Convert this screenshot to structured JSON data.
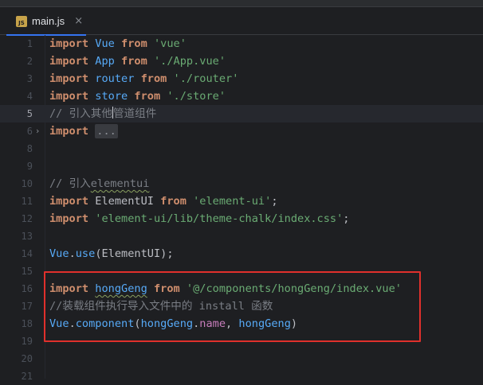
{
  "tab": {
    "icon": "javascript-file-icon",
    "icon_text": "JS",
    "label": "main.js",
    "close": "×"
  },
  "lines": [
    {
      "n": "1",
      "tokens": [
        {
          "t": "import",
          "c": "kw"
        },
        {
          "t": " "
        },
        {
          "t": "Vue",
          "c": "fn"
        },
        {
          "t": " "
        },
        {
          "t": "from",
          "c": "kw"
        },
        {
          "t": " "
        },
        {
          "t": "'vue'",
          "c": "str"
        }
      ]
    },
    {
      "n": "2",
      "tokens": [
        {
          "t": "import",
          "c": "kw"
        },
        {
          "t": " "
        },
        {
          "t": "App",
          "c": "fn"
        },
        {
          "t": " "
        },
        {
          "t": "from",
          "c": "kw"
        },
        {
          "t": " "
        },
        {
          "t": "'./App.vue'",
          "c": "str"
        }
      ]
    },
    {
      "n": "3",
      "tokens": [
        {
          "t": "import",
          "c": "kw"
        },
        {
          "t": " "
        },
        {
          "t": "router",
          "c": "fn"
        },
        {
          "t": " "
        },
        {
          "t": "from",
          "c": "kw"
        },
        {
          "t": " "
        },
        {
          "t": "'./router'",
          "c": "str"
        }
      ]
    },
    {
      "n": "4",
      "tokens": [
        {
          "t": "import",
          "c": "kw"
        },
        {
          "t": " "
        },
        {
          "t": "store",
          "c": "fn"
        },
        {
          "t": " "
        },
        {
          "t": "from",
          "c": "kw"
        },
        {
          "t": " "
        },
        {
          "t": "'./store'",
          "c": "str"
        }
      ]
    },
    {
      "n": "5",
      "current": true,
      "tokens": [
        {
          "t": "// ",
          "c": "cm"
        },
        {
          "t": "引入其他",
          "c": "cm cjk"
        },
        {
          "t": "",
          "c": "caret"
        },
        {
          "t": "管道组件",
          "c": "cm cjk"
        }
      ]
    },
    {
      "n": "6",
      "fold": "›",
      "tokens": [
        {
          "t": "import",
          "c": "kw"
        },
        {
          "t": " "
        },
        {
          "t": "...",
          "c": "folded"
        }
      ]
    },
    {
      "n": "8",
      "tokens": []
    },
    {
      "n": "9",
      "tokens": []
    },
    {
      "n": "10",
      "tokens": [
        {
          "t": "// ",
          "c": "cm"
        },
        {
          "t": "引入",
          "c": "cm cjk"
        },
        {
          "t": "elementui",
          "c": "cm typo"
        }
      ]
    },
    {
      "n": "11",
      "tokens": [
        {
          "t": "import",
          "c": "kw"
        },
        {
          "t": " "
        },
        {
          "t": "ElementUI",
          "c": "id"
        },
        {
          "t": " "
        },
        {
          "t": "from",
          "c": "kw"
        },
        {
          "t": " "
        },
        {
          "t": "'element-ui'",
          "c": "str"
        },
        {
          "t": ";"
        }
      ]
    },
    {
      "n": "12",
      "tokens": [
        {
          "t": "import",
          "c": "kw"
        },
        {
          "t": " "
        },
        {
          "t": "'element-ui/lib/theme-chalk/index.css'",
          "c": "str"
        },
        {
          "t": ";"
        }
      ]
    },
    {
      "n": "13",
      "tokens": []
    },
    {
      "n": "14",
      "tokens": [
        {
          "t": "Vue",
          "c": "fn"
        },
        {
          "t": "."
        },
        {
          "t": "use",
          "c": "fn"
        },
        {
          "t": "(ElementUI);"
        }
      ]
    },
    {
      "n": "15",
      "tokens": []
    },
    {
      "n": "16",
      "tokens": [
        {
          "t": "import",
          "c": "kw"
        },
        {
          "t": " "
        },
        {
          "t": "hongGeng",
          "c": "fn typo"
        },
        {
          "t": " "
        },
        {
          "t": "from",
          "c": "kw"
        },
        {
          "t": " "
        },
        {
          "t": "'@/components/hongGeng/index.vue'",
          "c": "str"
        }
      ]
    },
    {
      "n": "17",
      "tokens": [
        {
          "t": "//",
          "c": "cm"
        },
        {
          "t": "装载组件执行导入文件中的",
          "c": "cm cjk"
        },
        {
          "t": " install ",
          "c": "cm"
        },
        {
          "t": "函数",
          "c": "cm cjk"
        }
      ]
    },
    {
      "n": "18",
      "tokens": [
        {
          "t": "Vue",
          "c": "fn"
        },
        {
          "t": "."
        },
        {
          "t": "component",
          "c": "fn"
        },
        {
          "t": "("
        },
        {
          "t": "hongGeng",
          "c": "fn"
        },
        {
          "t": "."
        },
        {
          "t": "name",
          "c": "prop"
        },
        {
          "t": ", "
        },
        {
          "t": "hongGeng",
          "c": "fn"
        },
        {
          "t": ")"
        }
      ]
    },
    {
      "n": "19",
      "tokens": []
    },
    {
      "n": "20",
      "tokens": []
    },
    {
      "n": "21",
      "tokens": []
    }
  ],
  "colors": {
    "background": "#1e1f22",
    "keyword": "#cf8e6d",
    "string": "#6aab73",
    "comment": "#7a7e85",
    "identifier": "#57aaf7",
    "highlight_box": "#e0302c"
  }
}
